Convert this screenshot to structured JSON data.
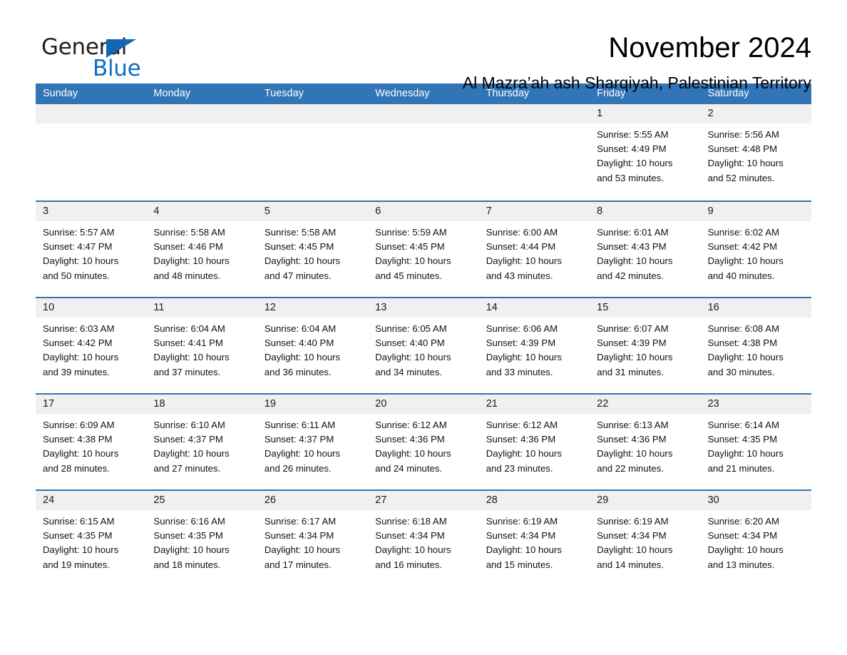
{
  "brand": {
    "name_part1": "General",
    "name_part2": "Blue",
    "accent_color": "#1267b2"
  },
  "header": {
    "title": "November 2024",
    "location": "Al Mazra’ah ash Sharqiyah, Palestinian Territory"
  },
  "calendar": {
    "header_bg": "#3275b6",
    "day_band_bg": "#f0f0f0",
    "weekdays": [
      "Sunday",
      "Monday",
      "Tuesday",
      "Wednesday",
      "Thursday",
      "Friday",
      "Saturday"
    ],
    "weeks": [
      [
        {
          "day": "",
          "sunrise": "",
          "sunset": "",
          "daylight_line1": "",
          "daylight_line2": ""
        },
        {
          "day": "",
          "sunrise": "",
          "sunset": "",
          "daylight_line1": "",
          "daylight_line2": ""
        },
        {
          "day": "",
          "sunrise": "",
          "sunset": "",
          "daylight_line1": "",
          "daylight_line2": ""
        },
        {
          "day": "",
          "sunrise": "",
          "sunset": "",
          "daylight_line1": "",
          "daylight_line2": ""
        },
        {
          "day": "",
          "sunrise": "",
          "sunset": "",
          "daylight_line1": "",
          "daylight_line2": ""
        },
        {
          "day": "1",
          "sunrise": "Sunrise: 5:55 AM",
          "sunset": "Sunset: 4:49 PM",
          "daylight_line1": "Daylight: 10 hours",
          "daylight_line2": "and 53 minutes."
        },
        {
          "day": "2",
          "sunrise": "Sunrise: 5:56 AM",
          "sunset": "Sunset: 4:48 PM",
          "daylight_line1": "Daylight: 10 hours",
          "daylight_line2": "and 52 minutes."
        }
      ],
      [
        {
          "day": "3",
          "sunrise": "Sunrise: 5:57 AM",
          "sunset": "Sunset: 4:47 PM",
          "daylight_line1": "Daylight: 10 hours",
          "daylight_line2": "and 50 minutes."
        },
        {
          "day": "4",
          "sunrise": "Sunrise: 5:58 AM",
          "sunset": "Sunset: 4:46 PM",
          "daylight_line1": "Daylight: 10 hours",
          "daylight_line2": "and 48 minutes."
        },
        {
          "day": "5",
          "sunrise": "Sunrise: 5:58 AM",
          "sunset": "Sunset: 4:45 PM",
          "daylight_line1": "Daylight: 10 hours",
          "daylight_line2": "and 47 minutes."
        },
        {
          "day": "6",
          "sunrise": "Sunrise: 5:59 AM",
          "sunset": "Sunset: 4:45 PM",
          "daylight_line1": "Daylight: 10 hours",
          "daylight_line2": "and 45 minutes."
        },
        {
          "day": "7",
          "sunrise": "Sunrise: 6:00 AM",
          "sunset": "Sunset: 4:44 PM",
          "daylight_line1": "Daylight: 10 hours",
          "daylight_line2": "and 43 minutes."
        },
        {
          "day": "8",
          "sunrise": "Sunrise: 6:01 AM",
          "sunset": "Sunset: 4:43 PM",
          "daylight_line1": "Daylight: 10 hours",
          "daylight_line2": "and 42 minutes."
        },
        {
          "day": "9",
          "sunrise": "Sunrise: 6:02 AM",
          "sunset": "Sunset: 4:42 PM",
          "daylight_line1": "Daylight: 10 hours",
          "daylight_line2": "and 40 minutes."
        }
      ],
      [
        {
          "day": "10",
          "sunrise": "Sunrise: 6:03 AM",
          "sunset": "Sunset: 4:42 PM",
          "daylight_line1": "Daylight: 10 hours",
          "daylight_line2": "and 39 minutes."
        },
        {
          "day": "11",
          "sunrise": "Sunrise: 6:04 AM",
          "sunset": "Sunset: 4:41 PM",
          "daylight_line1": "Daylight: 10 hours",
          "daylight_line2": "and 37 minutes."
        },
        {
          "day": "12",
          "sunrise": "Sunrise: 6:04 AM",
          "sunset": "Sunset: 4:40 PM",
          "daylight_line1": "Daylight: 10 hours",
          "daylight_line2": "and 36 minutes."
        },
        {
          "day": "13",
          "sunrise": "Sunrise: 6:05 AM",
          "sunset": "Sunset: 4:40 PM",
          "daylight_line1": "Daylight: 10 hours",
          "daylight_line2": "and 34 minutes."
        },
        {
          "day": "14",
          "sunrise": "Sunrise: 6:06 AM",
          "sunset": "Sunset: 4:39 PM",
          "daylight_line1": "Daylight: 10 hours",
          "daylight_line2": "and 33 minutes."
        },
        {
          "day": "15",
          "sunrise": "Sunrise: 6:07 AM",
          "sunset": "Sunset: 4:39 PM",
          "daylight_line1": "Daylight: 10 hours",
          "daylight_line2": "and 31 minutes."
        },
        {
          "day": "16",
          "sunrise": "Sunrise: 6:08 AM",
          "sunset": "Sunset: 4:38 PM",
          "daylight_line1": "Daylight: 10 hours",
          "daylight_line2": "and 30 minutes."
        }
      ],
      [
        {
          "day": "17",
          "sunrise": "Sunrise: 6:09 AM",
          "sunset": "Sunset: 4:38 PM",
          "daylight_line1": "Daylight: 10 hours",
          "daylight_line2": "and 28 minutes."
        },
        {
          "day": "18",
          "sunrise": "Sunrise: 6:10 AM",
          "sunset": "Sunset: 4:37 PM",
          "daylight_line1": "Daylight: 10 hours",
          "daylight_line2": "and 27 minutes."
        },
        {
          "day": "19",
          "sunrise": "Sunrise: 6:11 AM",
          "sunset": "Sunset: 4:37 PM",
          "daylight_line1": "Daylight: 10 hours",
          "daylight_line2": "and 26 minutes."
        },
        {
          "day": "20",
          "sunrise": "Sunrise: 6:12 AM",
          "sunset": "Sunset: 4:36 PM",
          "daylight_line1": "Daylight: 10 hours",
          "daylight_line2": "and 24 minutes."
        },
        {
          "day": "21",
          "sunrise": "Sunrise: 6:12 AM",
          "sunset": "Sunset: 4:36 PM",
          "daylight_line1": "Daylight: 10 hours",
          "daylight_line2": "and 23 minutes."
        },
        {
          "day": "22",
          "sunrise": "Sunrise: 6:13 AM",
          "sunset": "Sunset: 4:36 PM",
          "daylight_line1": "Daylight: 10 hours",
          "daylight_line2": "and 22 minutes."
        },
        {
          "day": "23",
          "sunrise": "Sunrise: 6:14 AM",
          "sunset": "Sunset: 4:35 PM",
          "daylight_line1": "Daylight: 10 hours",
          "daylight_line2": "and 21 minutes."
        }
      ],
      [
        {
          "day": "24",
          "sunrise": "Sunrise: 6:15 AM",
          "sunset": "Sunset: 4:35 PM",
          "daylight_line1": "Daylight: 10 hours",
          "daylight_line2": "and 19 minutes."
        },
        {
          "day": "25",
          "sunrise": "Sunrise: 6:16 AM",
          "sunset": "Sunset: 4:35 PM",
          "daylight_line1": "Daylight: 10 hours",
          "daylight_line2": "and 18 minutes."
        },
        {
          "day": "26",
          "sunrise": "Sunrise: 6:17 AM",
          "sunset": "Sunset: 4:34 PM",
          "daylight_line1": "Daylight: 10 hours",
          "daylight_line2": "and 17 minutes."
        },
        {
          "day": "27",
          "sunrise": "Sunrise: 6:18 AM",
          "sunset": "Sunset: 4:34 PM",
          "daylight_line1": "Daylight: 10 hours",
          "daylight_line2": "and 16 minutes."
        },
        {
          "day": "28",
          "sunrise": "Sunrise: 6:19 AM",
          "sunset": "Sunset: 4:34 PM",
          "daylight_line1": "Daylight: 10 hours",
          "daylight_line2": "and 15 minutes."
        },
        {
          "day": "29",
          "sunrise": "Sunrise: 6:19 AM",
          "sunset": "Sunset: 4:34 PM",
          "daylight_line1": "Daylight: 10 hours",
          "daylight_line2": "and 14 minutes."
        },
        {
          "day": "30",
          "sunrise": "Sunrise: 6:20 AM",
          "sunset": "Sunset: 4:34 PM",
          "daylight_line1": "Daylight: 10 hours",
          "daylight_line2": "and 13 minutes."
        }
      ]
    ]
  }
}
